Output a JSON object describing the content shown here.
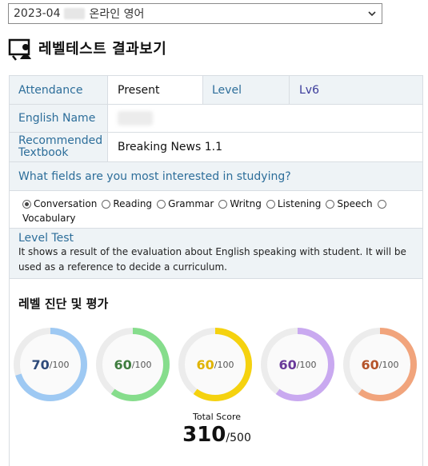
{
  "month_select": {
    "prefix": "2023-04",
    "suffix": "온라인 영어"
  },
  "heading": {
    "title": "레벨테스트 결과보기",
    "icon": "teacher-board-icon"
  },
  "info": {
    "attendance_label": "Attendance",
    "attendance_value": "Present",
    "level_label": "Level",
    "level_value": "Lv6",
    "english_name_label": "English Name",
    "textbook_label": "Recommended Textbook",
    "textbook_value": "Breaking News 1.1",
    "fields_question": "What fields are you most interested in studying?"
  },
  "fields": [
    {
      "label": "Conversation",
      "selected": true
    },
    {
      "label": "Reading",
      "selected": false
    },
    {
      "label": "Grammar",
      "selected": false
    },
    {
      "label": "Writng",
      "selected": false
    },
    {
      "label": "Listening",
      "selected": false
    },
    {
      "label": "Speech",
      "selected": false
    },
    {
      "label": "Vocabulary",
      "selected": false
    }
  ],
  "level_test": {
    "title": "Level Test",
    "description": "It shows a result of the evaluation about English speaking with student. It will be used as a reference to decide a curriculum."
  },
  "evaluation": {
    "title": "레벨 진단 및 평가",
    "scores": [
      {
        "score": "70",
        "max": "/100",
        "fraction": 0.7,
        "color": "#9ec9f3",
        "text_color": "#2e4a7a"
      },
      {
        "score": "60",
        "max": "/100",
        "fraction": 0.6,
        "color": "#86dd8c",
        "text_color": "#3f7d3f"
      },
      {
        "score": "60",
        "max": "/100",
        "fraction": 0.6,
        "color": "#f5d20f",
        "text_color": "#e0b400"
      },
      {
        "score": "60",
        "max": "/100",
        "fraction": 0.6,
        "color": "#c9a9f0",
        "text_color": "#6a3a9a"
      },
      {
        "score": "60",
        "max": "/100",
        "fraction": 0.6,
        "color": "#f1a47c",
        "text_color": "#b5542a"
      }
    ],
    "total_label": "Total Score",
    "total_score": "310",
    "total_max": "/500"
  }
}
